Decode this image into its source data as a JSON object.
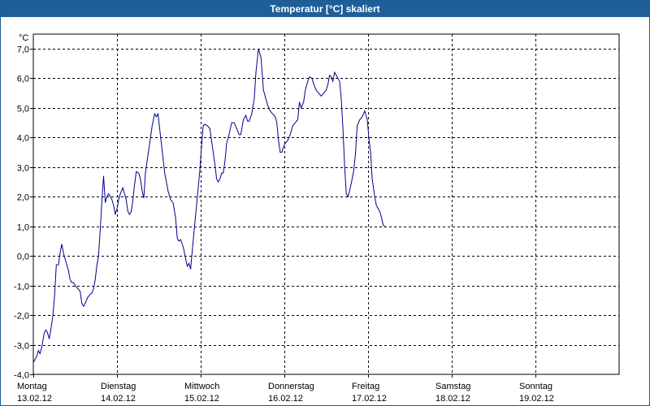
{
  "window": {
    "title": "Temperatur [°C] skaliert"
  },
  "chart_data": {
    "type": "line",
    "title": "Temperatur [°C] skaliert",
    "ylabel": "°C",
    "xlabel": "",
    "ylim": [
      -4.0,
      7.5
    ],
    "xlim": [
      0,
      7
    ],
    "grid": true,
    "colors": {
      "line": "#00008b",
      "grid": "#000000",
      "axis": "#000000"
    },
    "y_ticks": [
      {
        "value": -4.0,
        "label": "-4,0"
      },
      {
        "value": -3.0,
        "label": "-3,0"
      },
      {
        "value": -2.0,
        "label": "-2,0"
      },
      {
        "value": -1.0,
        "label": "-1,0"
      },
      {
        "value": 0.0,
        "label": "0,0"
      },
      {
        "value": 1.0,
        "label": "1,0"
      },
      {
        "value": 2.0,
        "label": "2,0"
      },
      {
        "value": 3.0,
        "label": "3,0"
      },
      {
        "value": 4.0,
        "label": "4,0"
      },
      {
        "value": 5.0,
        "label": "5,0"
      },
      {
        "value": 6.0,
        "label": "6,0"
      },
      {
        "value": 7.0,
        "label": "7,0"
      }
    ],
    "x_ticks": [
      {
        "value": 0,
        "day": "Montag",
        "date": "13.02.12"
      },
      {
        "value": 1,
        "day": "Dienstag",
        "date": "14.02.12"
      },
      {
        "value": 2,
        "day": "Mittwoch",
        "date": "15.02.12"
      },
      {
        "value": 3,
        "day": "Donnerstag",
        "date": "16.02.12"
      },
      {
        "value": 4,
        "day": "Freitag",
        "date": "17.02.12"
      },
      {
        "value": 5,
        "day": "Samstag",
        "date": "18.02.12"
      },
      {
        "value": 6,
        "day": "Sonntag",
        "date": "19.02.12"
      }
    ],
    "series": [
      {
        "points": [
          [
            0.0,
            -3.6
          ],
          [
            0.04,
            -3.4
          ],
          [
            0.06,
            -3.2
          ],
          [
            0.08,
            -3.3
          ],
          [
            0.1,
            -3.1
          ],
          [
            0.13,
            -2.6
          ],
          [
            0.15,
            -2.5
          ],
          [
            0.17,
            -2.6
          ],
          [
            0.19,
            -2.8
          ],
          [
            0.215,
            -2.4
          ],
          [
            0.235,
            -2.0
          ],
          [
            0.255,
            -1.3
          ],
          [
            0.275,
            -0.3
          ],
          [
            0.3,
            -0.3
          ],
          [
            0.32,
            0.1
          ],
          [
            0.34,
            0.4
          ],
          [
            0.36,
            0.1
          ],
          [
            0.38,
            -0.1
          ],
          [
            0.4,
            -0.3
          ],
          [
            0.42,
            -0.5
          ],
          [
            0.44,
            -0.8
          ],
          [
            0.46,
            -0.9
          ],
          [
            0.48,
            -0.9
          ],
          [
            0.5,
            -1.0
          ],
          [
            0.53,
            -1.1
          ],
          [
            0.56,
            -1.2
          ],
          [
            0.58,
            -1.6
          ],
          [
            0.6,
            -1.7
          ],
          [
            0.62,
            -1.6
          ],
          [
            0.65,
            -1.4
          ],
          [
            0.68,
            -1.3
          ],
          [
            0.7,
            -1.25
          ],
          [
            0.72,
            -1.1
          ],
          [
            0.74,
            -0.8
          ],
          [
            0.76,
            -0.3
          ],
          [
            0.78,
            0.0
          ],
          [
            0.8,
            0.9
          ],
          [
            0.82,
            1.9
          ],
          [
            0.84,
            2.7
          ],
          [
            0.86,
            1.8
          ],
          [
            0.88,
            2.0
          ],
          [
            0.9,
            2.1
          ],
          [
            0.92,
            2.0
          ],
          [
            0.94,
            1.9
          ],
          [
            0.96,
            1.7
          ],
          [
            0.98,
            1.4
          ],
          [
            1.0,
            1.6
          ],
          [
            1.02,
            1.9
          ],
          [
            1.04,
            2.1
          ],
          [
            1.07,
            2.3
          ],
          [
            1.09,
            2.1
          ],
          [
            1.11,
            1.9
          ],
          [
            1.13,
            1.5
          ],
          [
            1.15,
            1.4
          ],
          [
            1.17,
            1.5
          ],
          [
            1.19,
            1.9
          ],
          [
            1.21,
            2.4
          ],
          [
            1.23,
            2.85
          ],
          [
            1.26,
            2.8
          ],
          [
            1.28,
            2.6
          ],
          [
            1.3,
            2.2
          ],
          [
            1.32,
            1.95
          ],
          [
            1.34,
            2.8
          ],
          [
            1.37,
            3.4
          ],
          [
            1.4,
            4.0
          ],
          [
            1.42,
            4.4
          ],
          [
            1.45,
            4.8
          ],
          [
            1.47,
            4.7
          ],
          [
            1.49,
            4.8
          ],
          [
            1.51,
            4.3
          ],
          [
            1.53,
            3.8
          ],
          [
            1.55,
            3.3
          ],
          [
            1.57,
            2.8
          ],
          [
            1.59,
            2.5
          ],
          [
            1.61,
            2.2
          ],
          [
            1.64,
            1.9
          ],
          [
            1.67,
            1.8
          ],
          [
            1.7,
            1.3
          ],
          [
            1.72,
            0.6
          ],
          [
            1.74,
            0.5
          ],
          [
            1.76,
            0.55
          ],
          [
            1.78,
            0.4
          ],
          [
            1.8,
            0.2
          ],
          [
            1.82,
            -0.1
          ],
          [
            1.84,
            -0.35
          ],
          [
            1.86,
            -0.25
          ],
          [
            1.88,
            -0.45
          ],
          [
            1.9,
            0.2
          ],
          [
            1.93,
            1.1
          ],
          [
            1.96,
            2.0
          ],
          [
            1.99,
            2.9
          ],
          [
            2.01,
            3.7
          ],
          [
            2.03,
            4.4
          ],
          [
            2.05,
            4.45
          ],
          [
            2.08,
            4.4
          ],
          [
            2.11,
            4.3
          ],
          [
            2.14,
            3.7
          ],
          [
            2.17,
            3.1
          ],
          [
            2.19,
            2.6
          ],
          [
            2.21,
            2.5
          ],
          [
            2.23,
            2.6
          ],
          [
            2.25,
            2.8
          ],
          [
            2.27,
            2.8
          ],
          [
            2.29,
            3.2
          ],
          [
            2.31,
            3.8
          ],
          [
            2.34,
            4.1
          ],
          [
            2.37,
            4.5
          ],
          [
            2.4,
            4.5
          ],
          [
            2.43,
            4.3
          ],
          [
            2.46,
            4.1
          ],
          [
            2.48,
            4.1
          ],
          [
            2.51,
            4.6
          ],
          [
            2.54,
            4.75
          ],
          [
            2.56,
            4.55
          ],
          [
            2.58,
            4.55
          ],
          [
            2.61,
            4.8
          ],
          [
            2.64,
            5.3
          ],
          [
            2.66,
            6.2
          ],
          [
            2.69,
            7.0
          ],
          [
            2.72,
            6.7
          ],
          [
            2.75,
            5.6
          ],
          [
            2.78,
            5.3
          ],
          [
            2.8,
            5.1
          ],
          [
            2.83,
            4.9
          ],
          [
            2.86,
            4.8
          ],
          [
            2.89,
            4.7
          ],
          [
            2.91,
            4.5
          ],
          [
            2.93,
            3.9
          ],
          [
            2.95,
            3.5
          ],
          [
            2.97,
            3.5
          ],
          [
            2.99,
            3.7
          ],
          [
            3.01,
            3.8
          ],
          [
            3.04,
            3.9
          ],
          [
            3.07,
            4.1
          ],
          [
            3.1,
            4.4
          ],
          [
            3.13,
            4.5
          ],
          [
            3.16,
            4.6
          ],
          [
            3.18,
            5.2
          ],
          [
            3.2,
            5.0
          ],
          [
            3.23,
            5.2
          ],
          [
            3.25,
            5.6
          ],
          [
            3.28,
            5.9
          ],
          [
            3.3,
            6.05
          ],
          [
            3.33,
            6.0
          ],
          [
            3.35,
            5.8
          ],
          [
            3.38,
            5.6
          ],
          [
            3.41,
            5.5
          ],
          [
            3.44,
            5.4
          ],
          [
            3.47,
            5.5
          ],
          [
            3.5,
            5.6
          ],
          [
            3.52,
            5.8
          ],
          [
            3.54,
            6.1
          ],
          [
            3.56,
            6.05
          ],
          [
            3.58,
            5.9
          ],
          [
            3.6,
            6.2
          ],
          [
            3.62,
            6.1
          ],
          [
            3.64,
            6.0
          ],
          [
            3.66,
            5.9
          ],
          [
            3.68,
            5.3
          ],
          [
            3.7,
            4.3
          ],
          [
            3.72,
            3.0
          ],
          [
            3.74,
            2.1
          ],
          [
            3.76,
            2.0
          ],
          [
            3.78,
            2.2
          ],
          [
            3.81,
            2.6
          ],
          [
            3.83,
            2.9
          ],
          [
            3.85,
            3.5
          ],
          [
            3.87,
            4.4
          ],
          [
            3.9,
            4.6
          ],
          [
            3.93,
            4.7
          ],
          [
            3.96,
            4.9
          ],
          [
            3.99,
            4.6
          ],
          [
            4.01,
            4.0
          ],
          [
            4.03,
            3.5
          ],
          [
            4.05,
            2.6
          ],
          [
            4.08,
            2.0
          ],
          [
            4.1,
            1.7
          ],
          [
            4.12,
            1.6
          ],
          [
            4.14,
            1.5
          ],
          [
            4.16,
            1.3
          ],
          [
            4.18,
            1.05
          ],
          [
            4.2,
            1.0
          ]
        ]
      }
    ]
  }
}
